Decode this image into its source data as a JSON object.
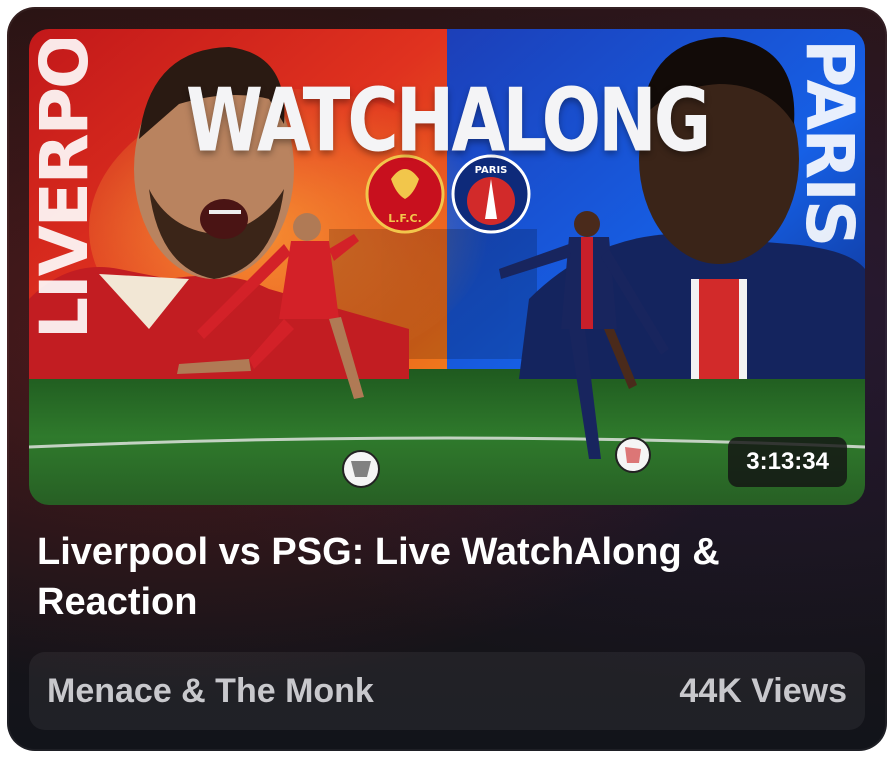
{
  "video": {
    "thumbnail": {
      "banner_text": "WATCHALONG",
      "left_side_text": "LIVERPOOL",
      "right_side_text": "PARIS",
      "left_crest_text": "L.F.C.",
      "right_crest_text": "PARIS",
      "left_color": "#d7261e",
      "right_color": "#1650c8",
      "pitch_color": "#2f7a2c"
    },
    "duration": "3:13:34",
    "title": "Liverpool vs PSG: Live WatchAlong & Reaction",
    "channel": "Menace & The Monk",
    "views": "44K Views"
  }
}
